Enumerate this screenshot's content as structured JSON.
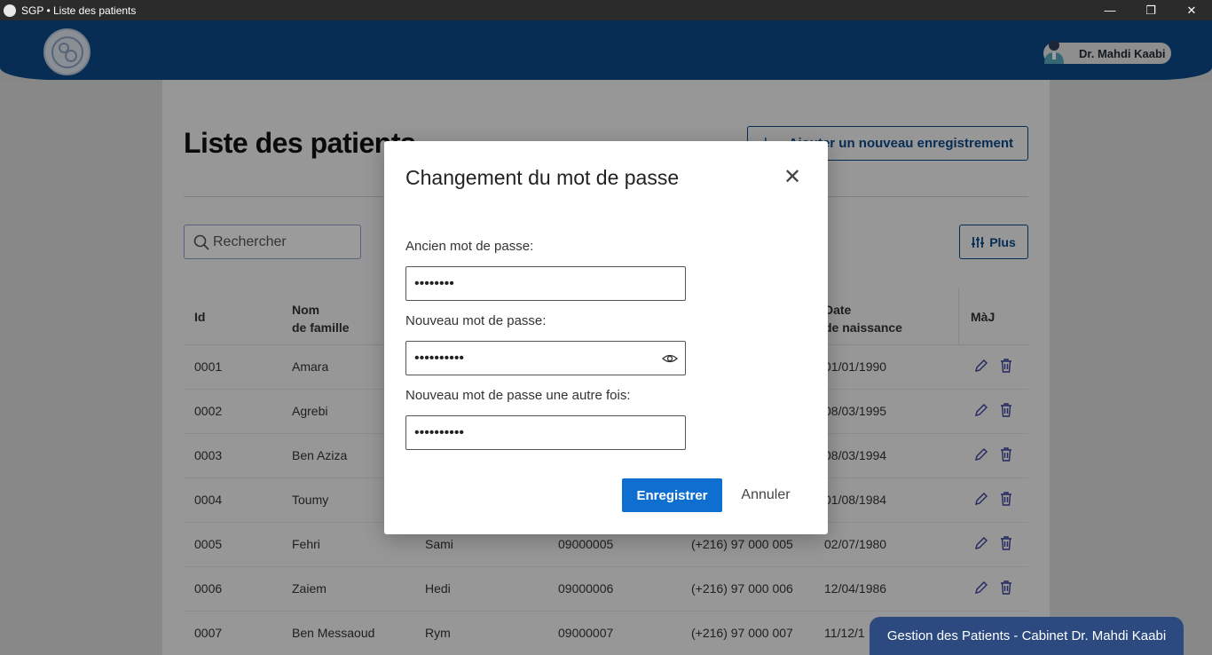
{
  "window": {
    "title": "SGP • Liste des patients",
    "minimize": "—",
    "maximize": "❐",
    "close": "✕"
  },
  "header": {
    "user_name": "Dr. Mahdi Kaabi"
  },
  "page": {
    "title": "Liste des patients",
    "add_button": "Ajouter un nouveau enregistrement",
    "search_placeholder": "Rechercher",
    "more_button": "Plus"
  },
  "table": {
    "headers": {
      "id": "Id",
      "nom_1": "Nom",
      "nom_2": "de famille",
      "date_1": "Date",
      "date_2": "de naissance",
      "maj": "MàJ"
    },
    "rows": [
      {
        "id": "0001",
        "nom": "Amara",
        "prenom": "",
        "cin": "",
        "tel": "",
        "date": "01/01/1990"
      },
      {
        "id": "0002",
        "nom": "Agrebi",
        "prenom": "",
        "cin": "",
        "tel": "",
        "date": "08/03/1995"
      },
      {
        "id": "0003",
        "nom": "Ben Aziza",
        "prenom": "",
        "cin": "",
        "tel": "",
        "date": "08/03/1994"
      },
      {
        "id": "0004",
        "nom": "Toumy",
        "prenom": "",
        "cin": "",
        "tel": "",
        "date": "01/08/1984"
      },
      {
        "id": "0005",
        "nom": "Fehri",
        "prenom": "Sami",
        "cin": "09000005",
        "tel": "(+216) 97 000 005",
        "date": "02/07/1980"
      },
      {
        "id": "0006",
        "nom": "Zaiem",
        "prenom": "Hedi",
        "cin": "09000006",
        "tel": "(+216) 97 000 006",
        "date": "12/04/1986"
      },
      {
        "id": "0007",
        "nom": "Ben Messaoud",
        "prenom": "Rym",
        "cin": "09000007",
        "tel": "(+216) 97 000 007",
        "date": "11/12/1"
      }
    ]
  },
  "modal": {
    "title": "Changement du mot de passe",
    "old_label": "Ancien mot de passe:",
    "old_value": "••••••••",
    "new_label": "Nouveau mot de passe:",
    "new_value": "••••••••••",
    "confirm_label": "Nouveau mot de passe une autre fois:",
    "confirm_value": "••••••••••",
    "save_button": "Enregistrer",
    "cancel_button": "Annuler",
    "close_glyph": "✕"
  },
  "toast": {
    "text": "Gestion des Patients - Cabinet Dr. Mahdi Kaabi"
  },
  "colors": {
    "header": "#0c4a8a",
    "primary": "#0f6fd1",
    "toast": "#2c4a80"
  }
}
